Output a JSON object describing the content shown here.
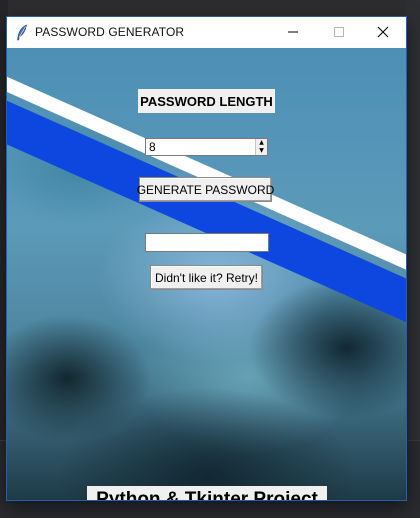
{
  "window": {
    "title": "PASSWORD GENERATOR",
    "icon": "feather-icon",
    "controls": {
      "minimize_icon": "minimize-icon",
      "maximize_icon": "maximize-icon",
      "close_icon": "close-icon"
    }
  },
  "main": {
    "length_label": "PASSWORD LENGTH",
    "length_value": "8",
    "generate_button": "GENERATE PASSWORD",
    "password_output_value": "",
    "retry_button": "Didn't like it? Retry!",
    "footer_label": "Python & Tkinter Project"
  },
  "colors": {
    "stripe_blue": "#0d47e0",
    "stripe_white": "#ffffff",
    "widget_bg": "#f0f0f0"
  }
}
